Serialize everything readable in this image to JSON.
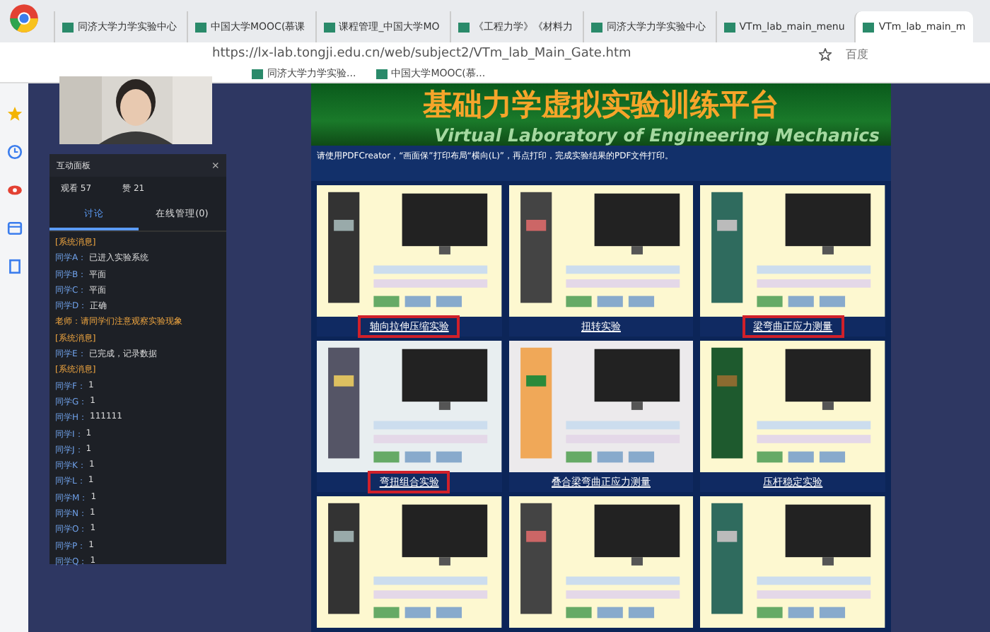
{
  "tabs": [
    {
      "label": "同济大学力学实验中心",
      "selected": false
    },
    {
      "label": "中国大学MOOC(慕课",
      "selected": false
    },
    {
      "label": "课程管理_中国大学MO",
      "selected": false
    },
    {
      "label": "《工程力学》《材料力",
      "selected": false
    },
    {
      "label": "同济大学力学实验中心",
      "selected": false
    },
    {
      "label": "VTm_lab_main_menu",
      "selected": false
    },
    {
      "label": "VTm_lab_main_m",
      "selected": true
    }
  ],
  "address_bar": {
    "url": "https://lx-lab.tongji.edu.cn/web/subject2/VTm_lab_Main_Gate.htm"
  },
  "search_box": {
    "placeholder": "百度"
  },
  "bookmarks": [
    "同济大学力学实验...",
    "中国大学MOOC(慕..."
  ],
  "panel": {
    "title": "互动面板",
    "close": "×",
    "views": "观看 57",
    "likes": "赞 21",
    "tabs": [
      {
        "label": "讨论",
        "selected": true
      },
      {
        "label": "在线管理(0)",
        "selected": false
      }
    ],
    "messages": [
      {
        "kind": "notice",
        "text": "[系统消息]"
      },
      {
        "kind": "chat",
        "name": "同学A：",
        "text": "已进入实验系统"
      },
      {
        "kind": "chat",
        "name": "同学B：",
        "text": "平面"
      },
      {
        "kind": "chat",
        "name": "同学C：",
        "text": "平面"
      },
      {
        "kind": "chat",
        "name": "同学D：",
        "text": "正确"
      },
      {
        "kind": "notice",
        "text": "老师：请同学们注意观察实验现象"
      },
      {
        "kind": "notice",
        "text": "[系统消息]"
      },
      {
        "kind": "chat",
        "name": "同学E：",
        "text": "已完成，记录数据"
      },
      {
        "kind": "notice",
        "text": "[系统消息]"
      },
      {
        "kind": "chat",
        "name": "同学F：",
        "text": "1"
      },
      {
        "kind": "chat",
        "name": "同学G：",
        "text": "1"
      },
      {
        "kind": "chat",
        "name": "同学H：",
        "text": "111111"
      },
      {
        "kind": "chat",
        "name": "同学I：",
        "text": "1"
      },
      {
        "kind": "chat",
        "name": "同学J：",
        "text": "1"
      },
      {
        "kind": "chat",
        "name": "同学K：",
        "text": "1"
      },
      {
        "kind": "chat",
        "name": "同学L：",
        "text": "1"
      },
      {
        "kind": "chat",
        "name": "同学M：",
        "text": "1"
      },
      {
        "kind": "chat",
        "name": "同学N：",
        "text": "1"
      },
      {
        "kind": "chat",
        "name": "同学O：",
        "text": "1"
      },
      {
        "kind": "chat",
        "name": "同学P：",
        "text": "1"
      },
      {
        "kind": "chat",
        "name": "同学Q：",
        "text": "1"
      }
    ]
  },
  "site": {
    "title": "基础力学虚拟实验训练平台",
    "subtitle": "Virtual Laboratory of Engineering Mechanics",
    "notice": "请使用PDFCreator，“画面保”打印布局“横向(L)”，再点打印，完成实验结果的PDF文件打印。",
    "experiments": [
      {
        "caption": "轴向拉伸压缩实验",
        "highlighted": true
      },
      {
        "caption": "扭转实验",
        "highlighted": false
      },
      {
        "caption": "梁弯曲正应力测量",
        "highlighted": true
      },
      {
        "caption": "弯扭组合实验",
        "highlighted": true
      },
      {
        "caption": "叠合梁弯曲正应力测量",
        "highlighted": false
      },
      {
        "caption": "压杆稳定实验",
        "highlighted": false
      },
      {
        "kind": "picture"
      },
      {
        "kind": "picture"
      },
      {
        "kind": "picture"
      }
    ]
  }
}
